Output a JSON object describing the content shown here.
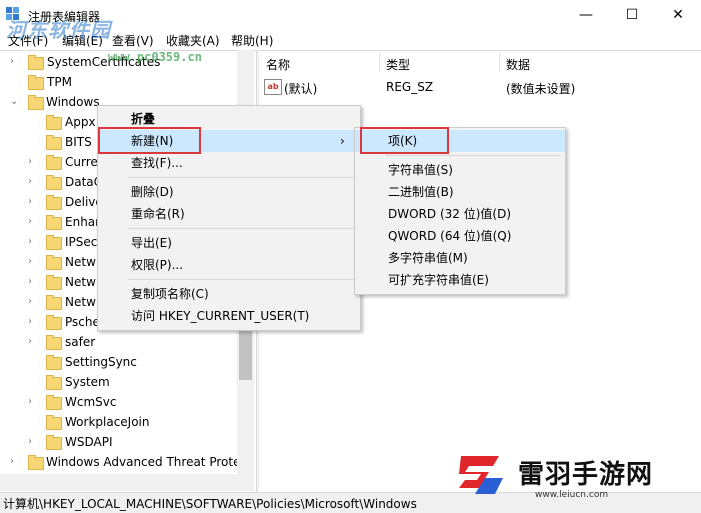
{
  "window": {
    "title": "注册表编辑器",
    "minimize_glyph": "—",
    "maximize_glyph": "☐",
    "close_glyph": "✕"
  },
  "menu": {
    "file": "文件(F)",
    "edit": "编辑(E)",
    "view": "查看(V)",
    "favorites": "收藏夹(A)",
    "help": "帮助(H)"
  },
  "watermark": {
    "site_name": "河东软件园",
    "site_url": "www.pc0359.cn"
  },
  "tree": {
    "items": [
      {
        "label": "SystemCertificates"
      },
      {
        "label": "TPM"
      },
      {
        "label": "Windows"
      },
      {
        "label": "Appx"
      },
      {
        "label": "BITS"
      },
      {
        "label": "Curre"
      },
      {
        "label": "DataC"
      },
      {
        "label": "Delive"
      },
      {
        "label": "Enhar"
      },
      {
        "label": "IPSec"
      },
      {
        "label": "Netw"
      },
      {
        "label": "Netw"
      },
      {
        "label": "Netw"
      },
      {
        "label": "Psche"
      },
      {
        "label": "safer"
      },
      {
        "label": "SettingSync"
      },
      {
        "label": "System"
      },
      {
        "label": "WcmSvc"
      },
      {
        "label": "WorkplaceJoin"
      },
      {
        "label": "WSDAPI"
      },
      {
        "label": "Windows Advanced Threat Prote"
      }
    ]
  },
  "list": {
    "headers": {
      "name": "名称",
      "type": "类型",
      "data": "数据"
    },
    "rows": [
      {
        "icon": "ab",
        "name": "(默认)",
        "type": "REG_SZ",
        "data": "(数值未设置)"
      }
    ]
  },
  "context_menu": {
    "collapse": "折叠",
    "new": "新建(N)",
    "new_arrow": "›",
    "find": "查找(F)...",
    "delete": "删除(D)",
    "rename": "重命名(R)",
    "export": "导出(E)",
    "permissions": "权限(P)...",
    "copy_key_name": "复制项名称(C)",
    "visit": "访问 HKEY_CURRENT_USER(T)"
  },
  "submenu": {
    "key": "项(K)",
    "string": "字符串值(S)",
    "binary": "二进制值(B)",
    "dword": "DWORD (32 位)值(D)",
    "qword": "QWORD (64 位)值(Q)",
    "multi_string": "多字符串值(M)",
    "expandable_string": "可扩充字符串值(E)"
  },
  "status": {
    "path": "计算机\\HKEY_LOCAL_MACHINE\\SOFTWARE\\Policies\\Microsoft\\Windows"
  },
  "brand": {
    "name": "雷羽手游网",
    "url": "www.leiucn.com",
    "color_red": "#e0262b",
    "color_blue": "#2a5fd6"
  },
  "colors": {
    "menu_highlight": "#cce8ff",
    "annotation_red": "#d9393e",
    "folder_yellow": "#f7d774"
  }
}
